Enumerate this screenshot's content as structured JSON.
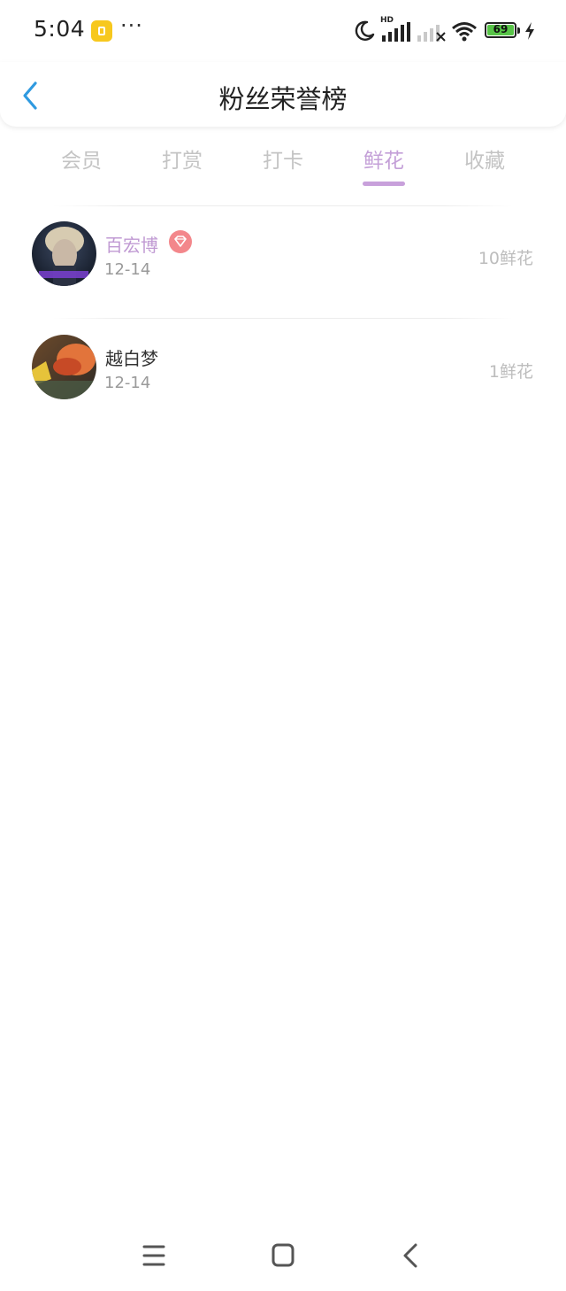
{
  "status_bar": {
    "time": "5:04",
    "more_indicator": "···",
    "battery_level": "69",
    "network_label": "HD",
    "icons": [
      "notification-app-icon",
      "moon-icon",
      "signal-icon",
      "signal-off-icon",
      "wifi-icon",
      "battery-icon",
      "charging-icon"
    ]
  },
  "header": {
    "title": "粉丝荣誉榜",
    "back_icon": "chevron-left-icon"
  },
  "tabs": [
    {
      "label": "会员",
      "active": false
    },
    {
      "label": "打赏",
      "active": false
    },
    {
      "label": "打卡",
      "active": false
    },
    {
      "label": "鲜花",
      "active": true
    },
    {
      "label": "收藏",
      "active": false
    }
  ],
  "list": [
    {
      "name": "百宏博",
      "date": "12-14",
      "count": "10鲜花",
      "vip": true,
      "badge_icon": "diamond-icon"
    },
    {
      "name": "越白梦",
      "date": "12-14",
      "count": "1鲜花",
      "vip": false
    }
  ],
  "nav_bar": {
    "icons": [
      "menu-icon",
      "home-icon",
      "back-icon"
    ]
  },
  "colors": {
    "accent": "#c8a0db",
    "back_arrow": "#2f9ae0",
    "badge": "#f3878b",
    "inactive_tab": "#c4c4c4",
    "battery_fill": "#58c448"
  }
}
